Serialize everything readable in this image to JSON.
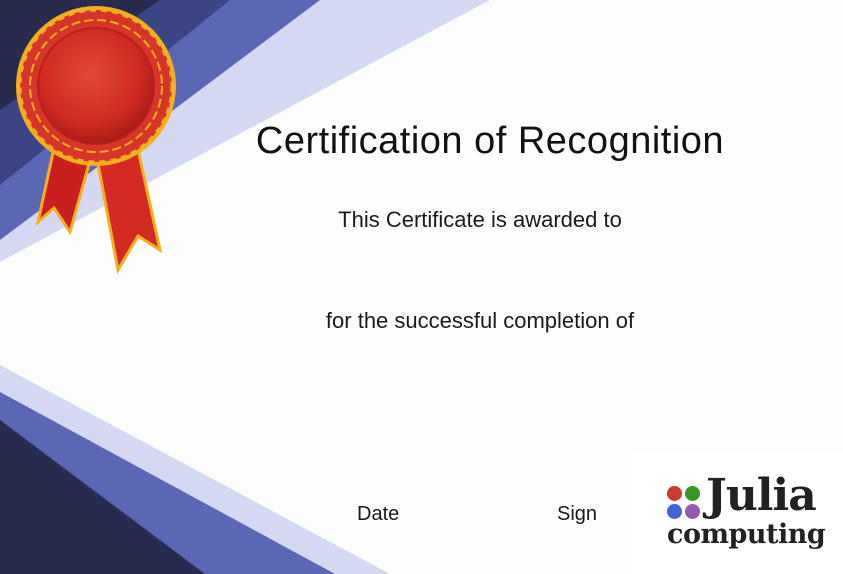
{
  "certificate": {
    "title": "Certification of Recognition",
    "awarded_line": "This Certificate is awarded to",
    "completion_line": "for the successful completion of",
    "date_label": "Date",
    "sign_label": "Sign"
  },
  "logo": {
    "word1": "Julia",
    "word2": "computing",
    "dot_colors": [
      "#cb3c33",
      "#389826",
      "#4063d8",
      "#9558b2"
    ]
  },
  "colors": {
    "navy": "#272c4f",
    "royal_blue": "#5a67b4",
    "pale_blue": "#d4d9f1",
    "ribbon_red": "#d42a23",
    "ribbon_gold": "#f2b01e"
  },
  "icons": {
    "award_ribbon": "rosette-ribbon-icon",
    "logo_dots": "four-dots-icon"
  }
}
